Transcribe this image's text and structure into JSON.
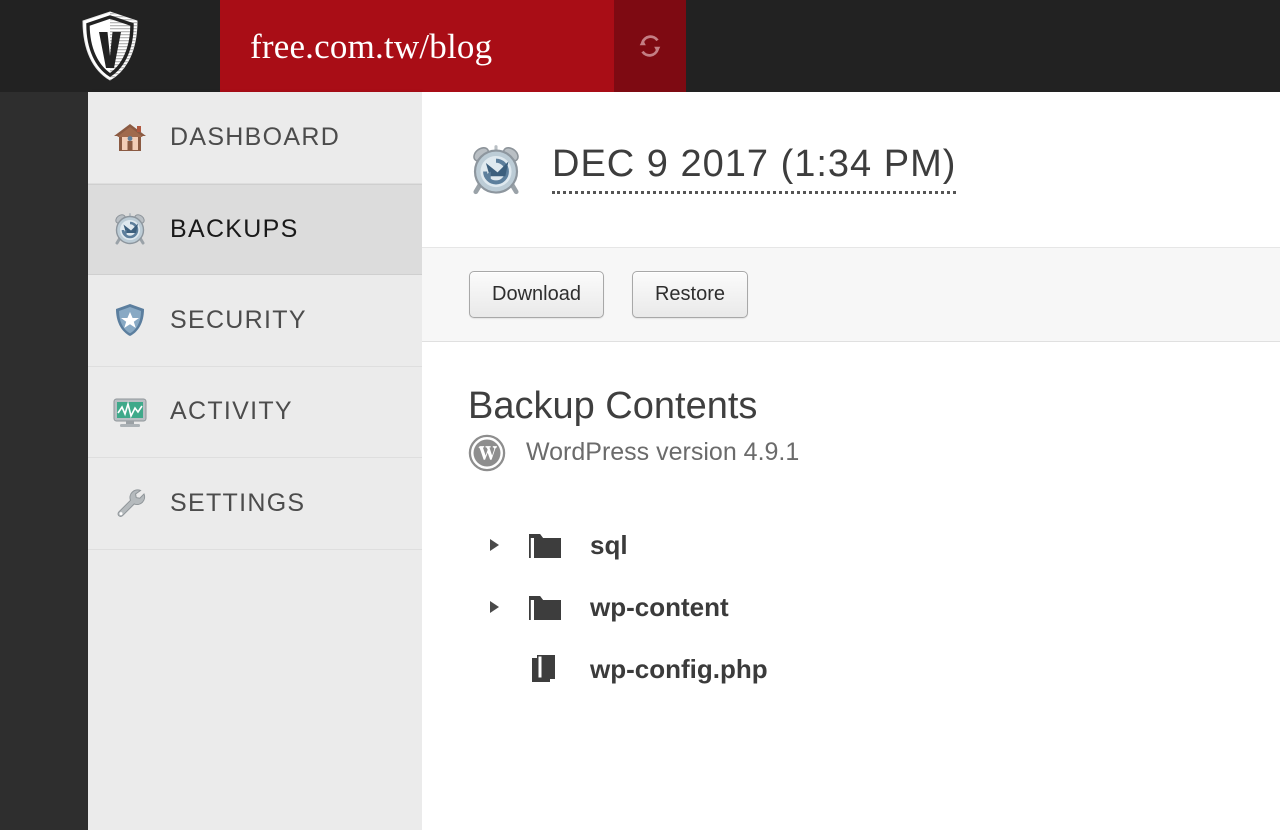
{
  "colors": {
    "brand_red": "#a90d16",
    "brand_red_dark": "#7e0a12",
    "topbar_dark": "#222222",
    "gutter_dark": "#2e2e2e",
    "sidebar_bg": "#ebebeb",
    "sidebar_active_bg": "#dcdcdc",
    "toolbar_bg": "#f7f7f7",
    "text_dark": "#3d3d3d",
    "text_muted": "#6b6b6b"
  },
  "topbar": {
    "logo_name": "vaultpress-shield-logo",
    "site_title": "free.com.tw/blog",
    "refresh_icon": "refresh-icon"
  },
  "sidebar": {
    "items": [
      {
        "label": "DASHBOARD",
        "icon": "house-icon",
        "active": false
      },
      {
        "label": "BACKUPS",
        "icon": "alarm-clock-icon",
        "active": true
      },
      {
        "label": "SECURITY",
        "icon": "shield-star-icon",
        "active": false
      },
      {
        "label": "ACTIVITY",
        "icon": "monitor-chart-icon",
        "active": false
      },
      {
        "label": "SETTINGS",
        "icon": "wrench-icon",
        "active": false
      }
    ]
  },
  "main": {
    "header": {
      "icon": "alarm-clock-icon",
      "backup_date": "DEC 9 2017 (1:34 PM)"
    },
    "toolbar": {
      "download_label": "Download",
      "restore_label": "Restore"
    },
    "contents": {
      "title": "Backup Contents",
      "wordpress_icon": "wordpress-icon",
      "wordpress_version": "WordPress version 4.9.1",
      "tree": [
        {
          "name": "sql",
          "type": "folder",
          "expandable": true,
          "expanded": false
        },
        {
          "name": "wp-content",
          "type": "folder",
          "expandable": true,
          "expanded": false
        },
        {
          "name": "wp-config.php",
          "type": "file",
          "expandable": false,
          "expanded": false
        }
      ]
    }
  }
}
